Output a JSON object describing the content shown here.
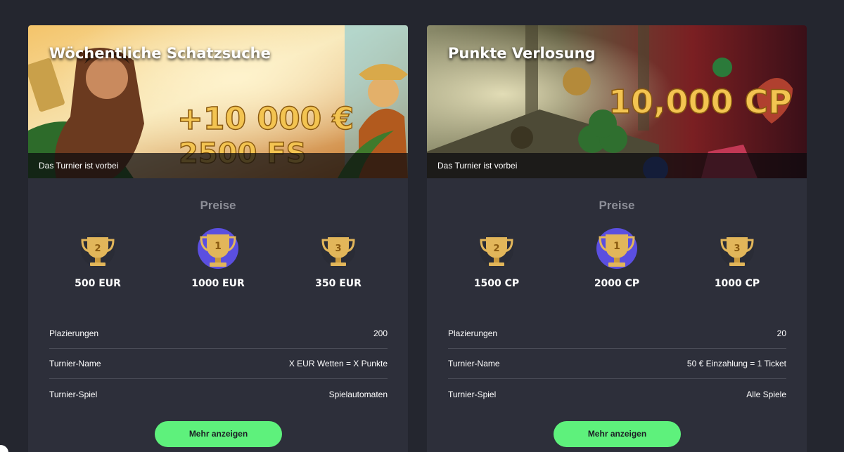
{
  "cards": [
    {
      "title": "Wöchentliche Schatzsuche",
      "status": "Das Turnier ist vorbei",
      "prizes_heading": "Preise",
      "prizes": [
        {
          "rank": "2",
          "value": "500 EUR"
        },
        {
          "rank": "1",
          "value": "1000 EUR"
        },
        {
          "rank": "3",
          "value": "350 EUR"
        }
      ],
      "banner_text": {
        "line1": "+10 000 €",
        "line2": "2500 FS"
      },
      "details": [
        {
          "label": "Plazierungen",
          "value": "200"
        },
        {
          "label": "Turnier-Name",
          "value": "X EUR Wetten = X Punkte"
        },
        {
          "label": "Turnier-Spiel",
          "value": "Spielautomaten"
        }
      ],
      "button_label": "Mehr anzeigen"
    },
    {
      "title": "Punkte Verlosung",
      "status": "Das Turnier ist vorbei",
      "prizes_heading": "Preise",
      "prizes": [
        {
          "rank": "2",
          "value": "1500 CP"
        },
        {
          "rank": "1",
          "value": "2000 CP"
        },
        {
          "rank": "3",
          "value": "1000 CP"
        }
      ],
      "banner_text": {
        "line1": "10,000 CP"
      },
      "details": [
        {
          "label": "Plazierungen",
          "value": "20"
        },
        {
          "label": "Turnier-Name",
          "value": "50 € Einzahlung = 1 Ticket"
        },
        {
          "label": "Turnier-Spiel",
          "value": "Alle Spiele"
        }
      ],
      "button_label": "Mehr anzeigen"
    }
  ],
  "colors": {
    "page_bg": "#24262f",
    "card_bg": "#2d2f3a",
    "button_green": "#5ef17c",
    "trophy_gold": "#e2b65a",
    "first_place_circle": "#5b4fe0",
    "muted_heading": "#8d8f98"
  },
  "icons": [
    "trophy-icon"
  ]
}
